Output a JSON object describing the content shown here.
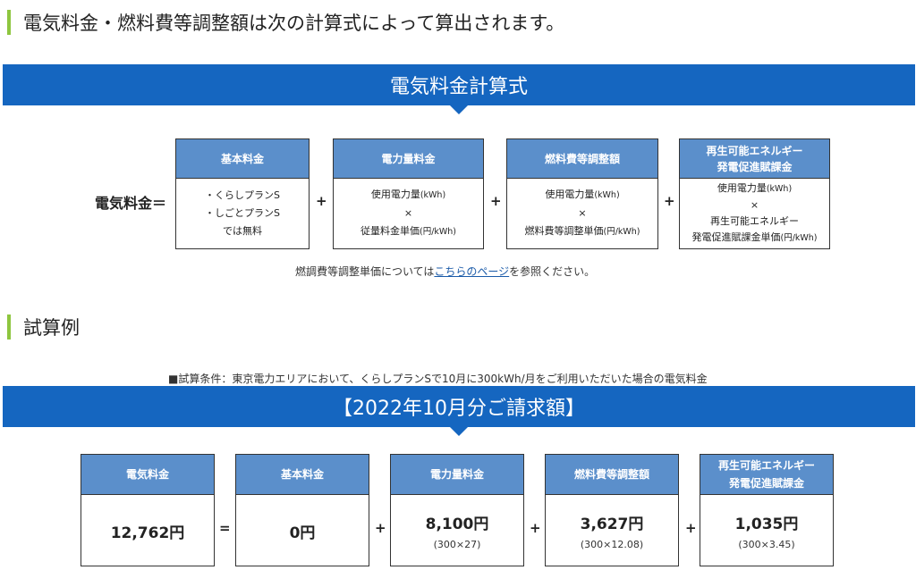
{
  "intro_heading": "電気料金・燃料費等調整額は次の計算式によって算出されます。",
  "formula": {
    "banner_title": "電気料金計算式",
    "left_label": "電気料金＝",
    "boxes": [
      {
        "title_lines": [
          "基本料金"
        ],
        "body_lines": [
          "・くらしプランS",
          "・しごとプランS",
          "では無料"
        ]
      },
      {
        "title_lines": [
          "電力量料金"
        ],
        "body_lines": [
          "使用電力量",
          "×",
          "従量料金単価"
        ],
        "body_suffixes": [
          "(kWh)",
          "",
          "(円/kWh)"
        ]
      },
      {
        "title_lines": [
          "燃料費等調整額"
        ],
        "body_lines": [
          "使用電力量",
          "×",
          "燃料費等調整単価"
        ],
        "body_suffixes": [
          "(kWh)",
          "",
          "(円/kWh)"
        ]
      },
      {
        "title_lines": [
          "再生可能エネルギー",
          "発電促進賦課金"
        ],
        "body_lines": [
          "使用電力量",
          "×",
          "再生可能エネルギー",
          "発電促進賦課金単価"
        ],
        "body_suffixes": [
          "(kWh)",
          "",
          "",
          "(円/kWh)"
        ]
      }
    ],
    "operators": [
      "+",
      "+",
      "+"
    ],
    "note_before": "燃調費等調整単価については",
    "note_link": "こちらのページ",
    "note_after": "を参照ください。"
  },
  "example_heading": "試算例",
  "example": {
    "condition": "■試算条件：東京電力エリアにおいて、くらしプランSで10月に300kWh/月をご利用いただいた場合の電気料金",
    "banner_title": "【2022年10月分ご請求額】",
    "boxes": [
      {
        "title_lines": [
          "電気料金"
        ],
        "value": "12,762円",
        "sub": ""
      },
      {
        "title_lines": [
          "基本料金"
        ],
        "value": "0円",
        "sub": ""
      },
      {
        "title_lines": [
          "電力量料金"
        ],
        "value": "8,100円",
        "sub": "(300×27)"
      },
      {
        "title_lines": [
          "燃料費等調整額"
        ],
        "value": "3,627円",
        "sub": "(300×12.08)"
      },
      {
        "title_lines": [
          "再生可能エネルギー",
          "発電促進賦課金"
        ],
        "value": "1,035円",
        "sub": "(300×3.45)"
      }
    ],
    "operators": [
      "=",
      "+",
      "+",
      "+"
    ]
  }
}
